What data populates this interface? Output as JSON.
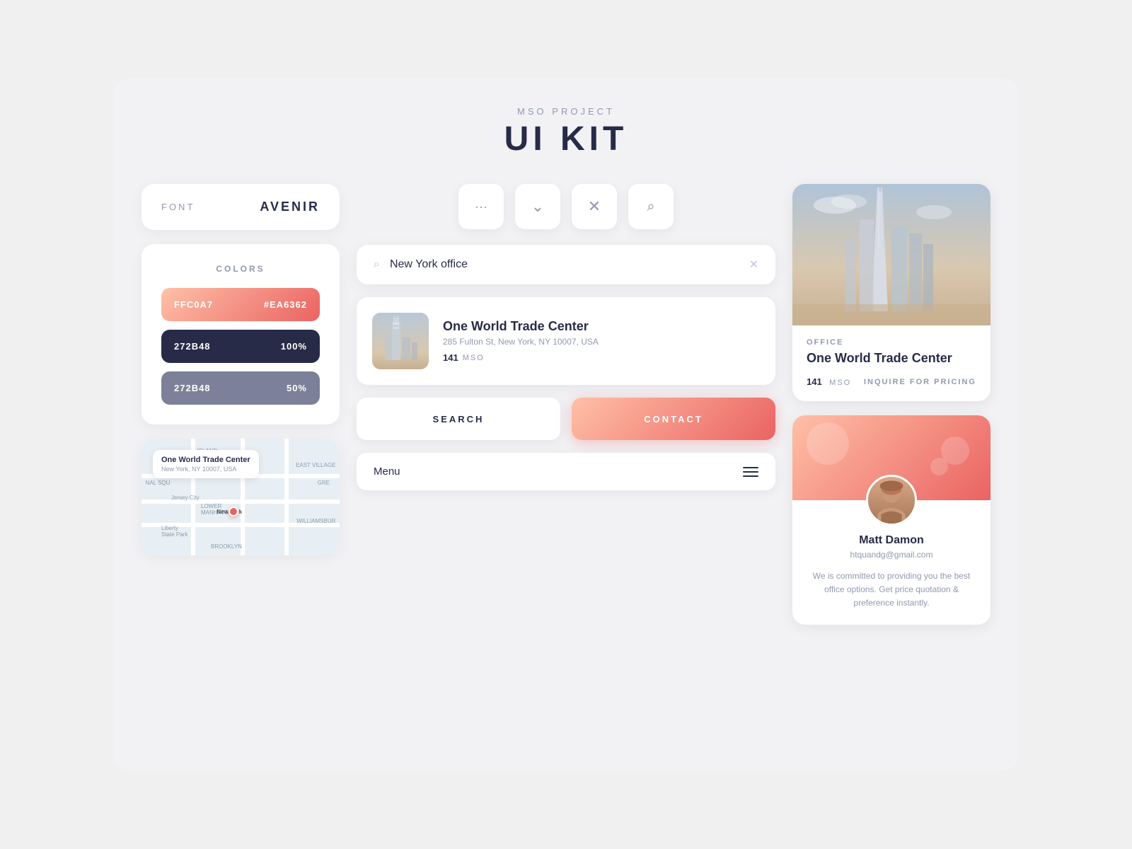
{
  "page": {
    "background": "#f0f0f3"
  },
  "header": {
    "subtitle": "MSO PROJECT",
    "title": "UI KIT"
  },
  "font_card": {
    "label": "FONT",
    "value": "AVENIR"
  },
  "colors_card": {
    "title": "COLORS",
    "swatches": [
      {
        "left": "FFC0A7",
        "right": "#EA6362",
        "type": "coral"
      },
      {
        "left": "272B48",
        "right": "100%",
        "type": "dark"
      },
      {
        "left": "272B48",
        "right": "50%",
        "type": "mid"
      }
    ]
  },
  "map_card": {
    "place_name": "One World Trade Center",
    "place_addr": "New York, NY 10007, USA"
  },
  "icon_buttons": [
    {
      "name": "dots-icon",
      "symbol": "···"
    },
    {
      "name": "chevron-down-icon",
      "symbol": "∨"
    },
    {
      "name": "close-icon",
      "symbol": "×"
    },
    {
      "name": "search-icon",
      "symbol": "⌕"
    }
  ],
  "search_bar": {
    "placeholder": "New York office",
    "value": "New York office"
  },
  "result_card": {
    "name": "One World Trade Center",
    "address": "285 Fulton St, New York, NY 10007, USA",
    "count": "141",
    "tag": "MSO"
  },
  "action_buttons": {
    "search_label": "SEARCH",
    "contact_label": "CONTACT"
  },
  "menu_bar": {
    "label": "Menu"
  },
  "office_card": {
    "type": "OFFICE",
    "name": "One World Trade Center",
    "count": "141",
    "count_label": "MSO",
    "pricing": "INQUIRE FOR PRICING"
  },
  "profile_card": {
    "name": "Matt Damon",
    "email": "htquandg@gmail.com",
    "description": "We is committed to providing you the best office options. Get price quotation & preference instantly."
  }
}
